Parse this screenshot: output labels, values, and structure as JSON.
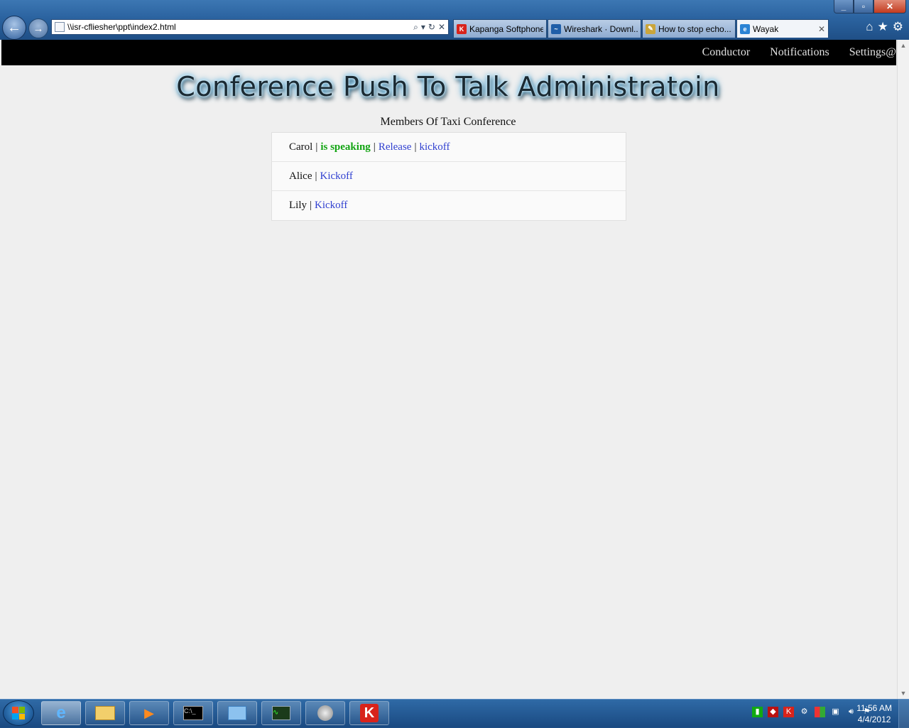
{
  "browser": {
    "address": "\\\\isr-cfliesher\\ppt\\index2.html",
    "tabs": [
      {
        "label": "Kapanga Softphone",
        "icon": "kapanga-icon"
      },
      {
        "label": "Wireshark · Downl...",
        "icon": "wireshark-icon"
      },
      {
        "label": "How to stop echo...",
        "icon": "pencil-icon"
      },
      {
        "label": "Wayak",
        "icon": "ie-icon",
        "active": true
      }
    ]
  },
  "nav": {
    "conductor": "Conductor",
    "notifications": "Notifications",
    "settings": "Settings@"
  },
  "page": {
    "banner": "Conference Push To Talk Administratoin",
    "subtitle": "Members Of Taxi Conference"
  },
  "members": [
    {
      "name": "Carol",
      "status": "is speaking",
      "release": "Release",
      "kick": "kickoff"
    },
    {
      "name": "Alice",
      "kick": "Kickoff"
    },
    {
      "name": "Lily",
      "kick": "Kickoff"
    }
  ],
  "taskbar": {
    "time": "11:56 AM",
    "date": "4/4/2012"
  },
  "colors": {
    "speaking": "#12a412",
    "link": "#2f3fd0",
    "topbar": "#000000"
  }
}
